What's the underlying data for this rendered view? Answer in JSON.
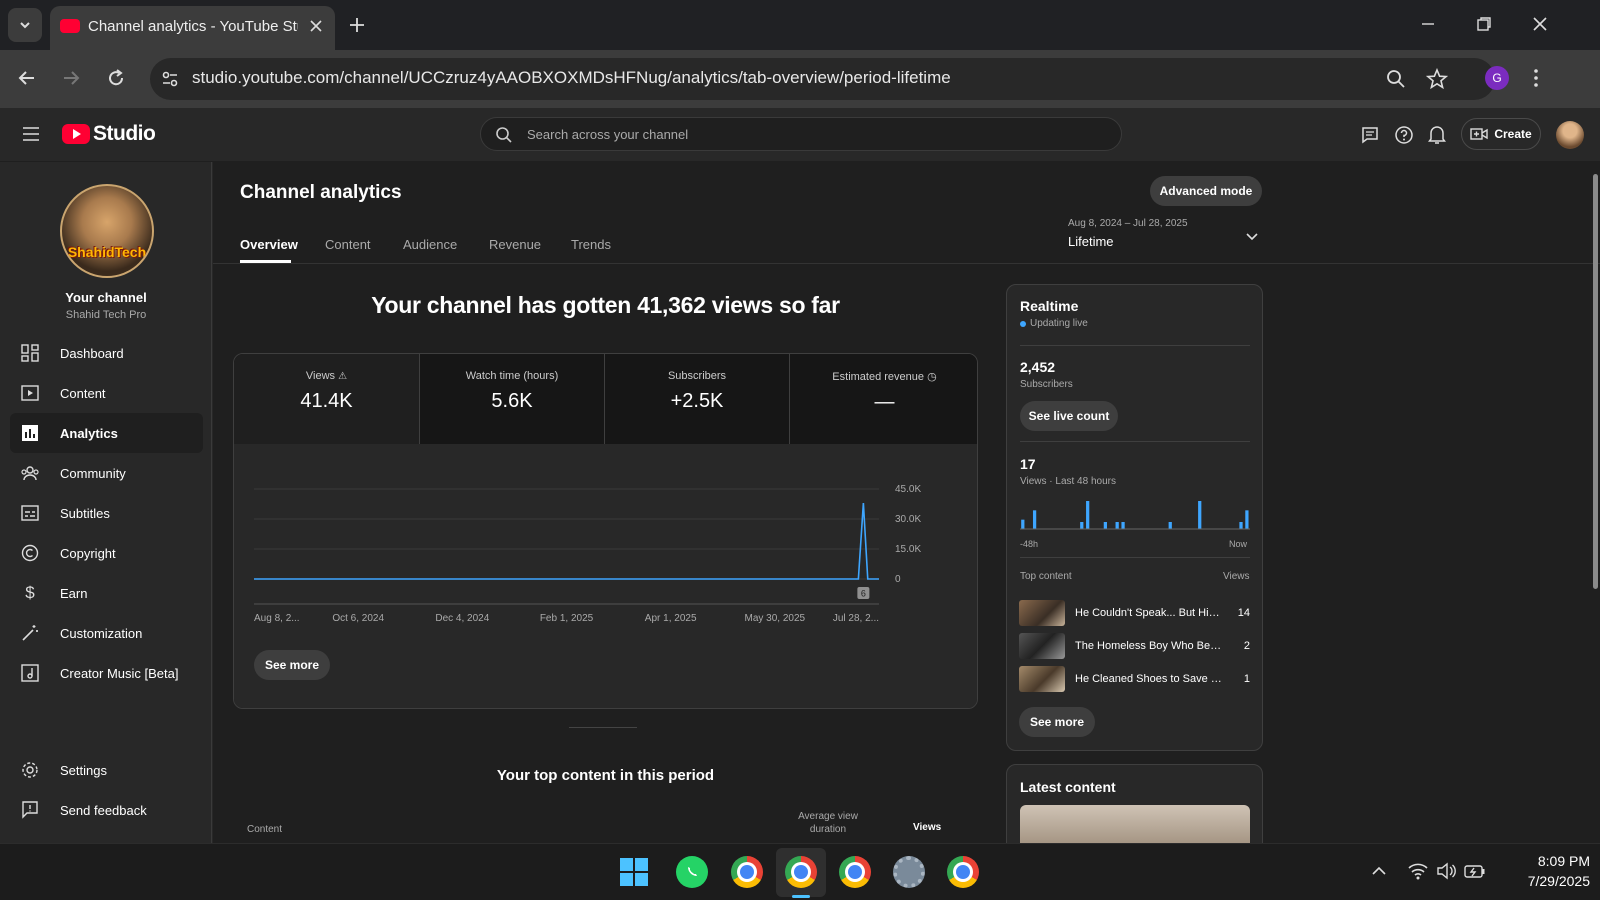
{
  "browser": {
    "tab_title": "Channel analytics - YouTube Stu",
    "url": "studio.youtube.com/channel/UCCzruz4yAAOBXOXMDsHFNug/analytics/tab-overview/period-lifetime",
    "profile_initial": "G"
  },
  "header": {
    "logo_text": "Studio",
    "search_placeholder": "Search across your channel",
    "create_label": "Create"
  },
  "sidebar": {
    "channel_label": "Your channel",
    "channel_name": "Shahid Tech Pro",
    "avatar_text": "ShahidTech",
    "items": [
      {
        "label": "Dashboard",
        "icon": "dashboard-icon"
      },
      {
        "label": "Content",
        "icon": "content-icon"
      },
      {
        "label": "Analytics",
        "icon": "analytics-icon"
      },
      {
        "label": "Community",
        "icon": "community-icon"
      },
      {
        "label": "Subtitles",
        "icon": "subtitles-icon"
      },
      {
        "label": "Copyright",
        "icon": "copyright-icon"
      },
      {
        "label": "Earn",
        "icon": "dollar-icon"
      },
      {
        "label": "Customization",
        "icon": "wand-icon"
      },
      {
        "label": "Creator Music [Beta]",
        "icon": "music-icon"
      }
    ],
    "bottom": [
      {
        "label": "Settings",
        "icon": "gear-icon"
      },
      {
        "label": "Send feedback",
        "icon": "feedback-icon"
      }
    ]
  },
  "main": {
    "title": "Channel analytics",
    "advanced_mode": "Advanced mode",
    "tabs": [
      "Overview",
      "Content",
      "Audience",
      "Revenue",
      "Trends"
    ],
    "period": {
      "range": "Aug 8, 2024 – Jul 28, 2025",
      "label": "Lifetime"
    },
    "headline": "Your channel has gotten 41,362 views so far",
    "metrics": [
      {
        "label": "Views",
        "value": "41.4K"
      },
      {
        "label": "Watch time (hours)",
        "value": "5.6K"
      },
      {
        "label": "Subscribers",
        "value": "+2.5K"
      },
      {
        "label": "Estimated revenue",
        "value": "—"
      }
    ],
    "see_more": "See more",
    "top_content_title": "Your top content in this period",
    "table_headers": {
      "content": "Content",
      "avg_view_duration": "Average view duration",
      "views": "Views"
    },
    "video_marker": "6"
  },
  "chart_data": {
    "type": "line",
    "x_ticks": [
      "Aug 8, 2...",
      "Oct 6, 2024",
      "Dec 4, 2024",
      "Feb 1, 2025",
      "Apr 1, 2025",
      "May 30, 2025",
      "Jul 28, 2..."
    ],
    "y_ticks": [
      "45.0K",
      "30.0K",
      "15.0K",
      "0"
    ],
    "ylim": [
      0,
      45000
    ],
    "series": [
      {
        "x": [
          0,
          0.5,
          0.95,
          0.967,
          0.975,
          0.982,
          0.99,
          1.0
        ],
        "values": [
          0,
          0,
          0,
          0,
          38000,
          0,
          0,
          0
        ]
      }
    ],
    "color": "#3ea6ff",
    "grid": true
  },
  "realtime": {
    "title": "Realtime",
    "status": "Updating live",
    "subscribers_value": "2,452",
    "subscribers_label": "Subscribers",
    "see_live_count": "See live count",
    "views_value": "17",
    "views_label": "Views · Last 48 hours",
    "axis_start": "-48h",
    "axis_end": "Now",
    "bars": [
      0.4,
      0,
      0.8,
      0,
      0,
      0,
      0,
      0,
      0,
      0,
      0.3,
      1.2,
      0,
      0,
      0.3,
      0,
      0.3,
      0.3,
      0,
      0,
      0,
      0,
      0,
      0,
      0,
      0.3,
      0,
      0,
      0,
      0,
      1.2,
      0,
      0,
      0,
      0,
      0,
      0,
      0.3,
      0.8
    ],
    "top_content_label": "Top content",
    "views_col": "Views",
    "top": [
      {
        "title": "He Couldn't Speak... But His ...",
        "views": "14"
      },
      {
        "title": "The Homeless Boy Who Beca...",
        "views": "2"
      },
      {
        "title": "He Cleaned Shoes to Save Hi...",
        "views": "1"
      }
    ],
    "see_more": "See more"
  },
  "latest": {
    "title": "Latest content"
  },
  "taskbar": {
    "time": "8:09 PM",
    "date": "7/29/2025"
  }
}
